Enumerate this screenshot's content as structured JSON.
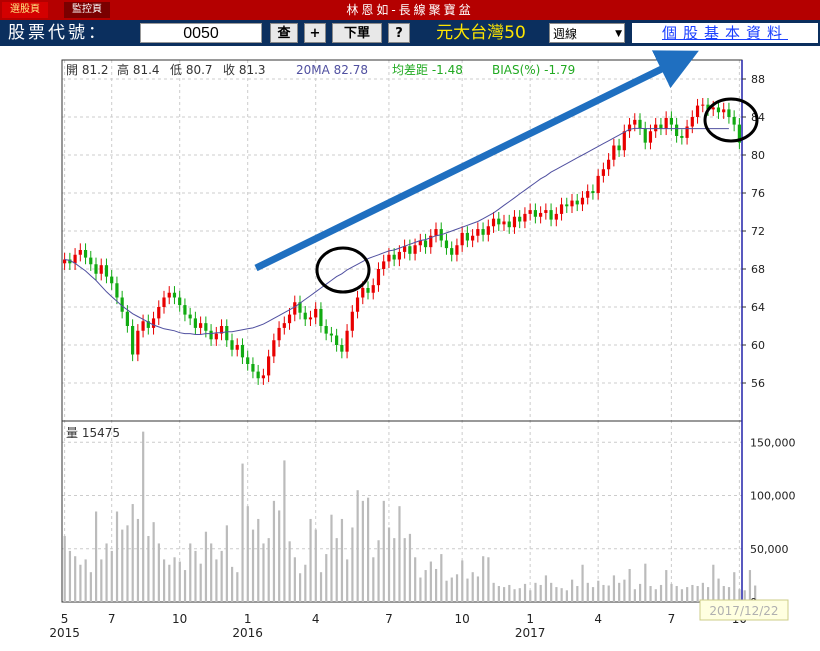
{
  "tabs": [
    {
      "label": "選股頁"
    },
    {
      "label": "監控頁"
    }
  ],
  "app_title": "林恩如-長線聚寶盆",
  "toolbar": {
    "code_label": "股票代號：",
    "code_value": "0050",
    "query_label": "查",
    "add_label": "+",
    "order_label": "下單",
    "help_label": "?",
    "stock_name": "元大台灣50",
    "period_selected": "週線",
    "info_link": "個股基本資料"
  },
  "price_info": {
    "open": "開 81.2",
    "high": "高 81.4",
    "low": "低 80.7",
    "close": "收 81.3",
    "ma": "20MA 82.78",
    "ma_diff": "均差距 -1.48",
    "bias": "BIAS(%) -1.79"
  },
  "volume_info": "量 15475",
  "date_tooltip": "2017/12/22",
  "colors": {
    "up": "#e80000",
    "down": "#11aa11",
    "ma": "#5050a0",
    "arrow": "#1f6fc0",
    "volume": "#bbbbbb"
  },
  "chart_data": [
    {
      "type": "candlestick",
      "yrange": [
        52,
        90
      ],
      "yticks": [
        56,
        60,
        64,
        68,
        72,
        76,
        80,
        84,
        88
      ],
      "grid": true,
      "x_ticks": [
        {
          "label": "5",
          "year": "2015",
          "week": 0
        },
        {
          "label": "7",
          "week": 9
        },
        {
          "label": "10",
          "week": 22
        },
        {
          "label": "1",
          "year": "2016",
          "week": 35
        },
        {
          "label": "4",
          "week": 48
        },
        {
          "label": "7",
          "week": 62
        },
        {
          "label": "10",
          "week": 76
        },
        {
          "label": "1",
          "year": "2017",
          "week": 89
        },
        {
          "label": "4",
          "week": 102
        },
        {
          "label": "7",
          "week": 116
        },
        {
          "label": "10",
          "week": 129
        }
      ],
      "closes": [
        69.0,
        68.6,
        69.5,
        70.0,
        69.2,
        68.5,
        67.5,
        68.4,
        67.2,
        66.5,
        65.0,
        63.5,
        62.0,
        59.0,
        61.5,
        62.5,
        61.8,
        62.8,
        64.0,
        65.0,
        65.5,
        65.0,
        64.2,
        63.2,
        62.8,
        61.8,
        62.3,
        61.5,
        60.6,
        61.2,
        62.0,
        60.5,
        59.5,
        60.0,
        58.7,
        58.0,
        57.2,
        56.5,
        56.8,
        58.8,
        60.5,
        61.8,
        62.3,
        63.2,
        64.5,
        63.4,
        62.7,
        62.9,
        63.8,
        62.0,
        61.2,
        61.0,
        60.0,
        59.3,
        61.5,
        63.5,
        65.0,
        66.0,
        65.5,
        66.3,
        68.0,
        68.8,
        69.5,
        69.0,
        69.8,
        70.4,
        69.6,
        70.5,
        71.0,
        70.3,
        71.5,
        72.2,
        71.0,
        70.2,
        69.5,
        70.5,
        71.8,
        71.0,
        71.5,
        72.2,
        71.6,
        72.5,
        73.3,
        72.7,
        73.0,
        72.4,
        73.5,
        73.0,
        73.8,
        74.2,
        73.5,
        73.9,
        74.2,
        73.2,
        73.8,
        74.8,
        74.6,
        75.2,
        74.8,
        75.5,
        76.2,
        76.0,
        77.8,
        78.5,
        79.5,
        81.0,
        80.5,
        82.5,
        83.2,
        83.7,
        82.8,
        81.3,
        82.5,
        83.2,
        82.8,
        83.9,
        83.2,
        82.0,
        81.8,
        83.0,
        84.0,
        85.2,
        85.3,
        84.8,
        85.0,
        84.5,
        84.8,
        84.0,
        83.2,
        81.3
      ],
      "ma20": [
        69.0,
        68.9,
        68.6,
        68.2,
        67.8,
        67.3,
        66.8,
        66.2,
        65.6,
        65.1,
        64.6,
        64.1,
        63.7,
        63.3,
        63.0,
        62.7,
        62.4,
        62.1,
        61.9,
        61.7,
        61.6,
        61.5,
        61.3,
        61.2,
        61.2,
        61.1,
        61.1,
        61.2,
        61.2,
        61.3,
        61.3,
        61.4,
        61.4,
        61.5,
        61.6,
        61.7,
        61.8,
        62.0,
        62.2,
        62.5,
        62.8,
        63.1,
        63.4,
        63.7,
        64.0,
        64.4,
        64.8,
        65.2,
        65.6,
        66.0,
        66.4,
        66.8,
        67.2,
        67.5,
        67.9,
        68.2,
        68.5,
        68.8,
        69.1,
        69.3,
        69.5,
        69.7,
        69.9,
        70.0,
        70.2,
        70.4,
        70.6,
        70.8,
        71.0,
        71.1,
        71.3,
        71.5,
        71.6,
        71.8,
        72.0,
        72.2,
        72.4,
        72.6,
        72.8,
        73.0,
        73.3,
        73.6,
        73.9,
        74.3,
        74.7,
        75.1,
        75.5,
        75.9,
        76.3,
        76.7,
        77.1,
        77.5,
        77.8,
        78.2,
        78.5,
        78.8,
        79.1,
        79.4,
        79.7,
        80.0,
        80.3,
        80.6,
        80.9,
        81.2,
        81.5,
        81.8,
        82.1,
        82.4,
        82.7,
        82.8,
        82.8,
        82.78,
        82.78,
        82.78,
        82.78,
        82.78,
        82.78,
        82.78,
        82.78,
        82.78,
        82.78,
        82.78,
        82.78,
        82.78,
        82.78,
        82.78,
        82.78,
        82.78
      ]
    },
    {
      "type": "bar",
      "yrange": [
        0,
        170000
      ],
      "yticks": [
        0,
        50000,
        100000,
        150000
      ],
      "volumes": [
        62000,
        48000,
        43000,
        35000,
        40000,
        28000,
        85000,
        40000,
        55000,
        48000,
        85000,
        68000,
        72000,
        92000,
        78000,
        160000,
        62000,
        75000,
        55000,
        40000,
        35000,
        42000,
        38000,
        30000,
        55000,
        48000,
        36000,
        66000,
        55000,
        40000,
        48000,
        72000,
        33000,
        28000,
        130000,
        90000,
        68000,
        78000,
        55000,
        60000,
        95000,
        86000,
        133000,
        57000,
        42000,
        27000,
        35000,
        78000,
        68000,
        28000,
        45000,
        82000,
        60000,
        78000,
        40000,
        70000,
        105000,
        95000,
        98000,
        42000,
        58000,
        95000,
        70000,
        60000,
        90000,
        60000,
        64000,
        42000,
        23000,
        30000,
        38000,
        31000,
        45000,
        20000,
        23000,
        26000,
        39000,
        22000,
        28000,
        24000,
        43000,
        42000,
        18000,
        15000,
        14000,
        16000,
        12000,
        13000,
        17000,
        11000,
        18000,
        16000,
        25000,
        18000,
        14000,
        13000,
        11000,
        21000,
        15000,
        35000,
        18000,
        14000,
        20000,
        16000,
        15475,
        25000,
        18000,
        21000,
        31000,
        12000,
        17000,
        36000,
        15000,
        12000,
        16000,
        30000,
        17000,
        15000,
        12000,
        14000,
        16000,
        15000,
        18000,
        14000,
        35000,
        22000,
        15000,
        14000,
        28000,
        12000,
        11000,
        30000,
        15475
      ]
    }
  ]
}
